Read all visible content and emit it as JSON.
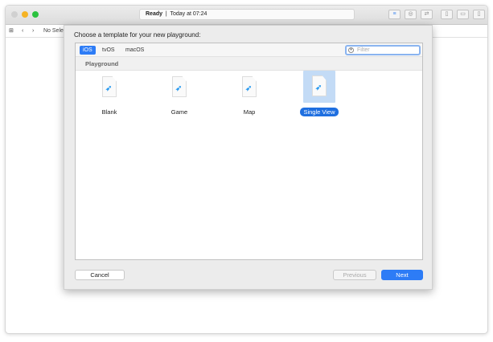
{
  "titlebar": {
    "status_ready": "Ready",
    "status_time": "Today at 07:24"
  },
  "navbar": {
    "no_selection": "No Sele"
  },
  "sheet": {
    "title": "Choose a template for your new playground:",
    "tabs": [
      {
        "label": "iOS",
        "selected": true
      },
      {
        "label": "tvOS"
      },
      {
        "label": "macOS"
      }
    ],
    "filter_placeholder": "Filter",
    "section": "Playground",
    "templates": [
      {
        "label": "Blank"
      },
      {
        "label": "Game"
      },
      {
        "label": "Map"
      },
      {
        "label": "Single View",
        "selected": true
      }
    ],
    "cancel": "Cancel",
    "previous": "Previous",
    "next": "Next"
  },
  "colors": {
    "accent": "#2d7cf6",
    "swift": "#2c9bef"
  }
}
